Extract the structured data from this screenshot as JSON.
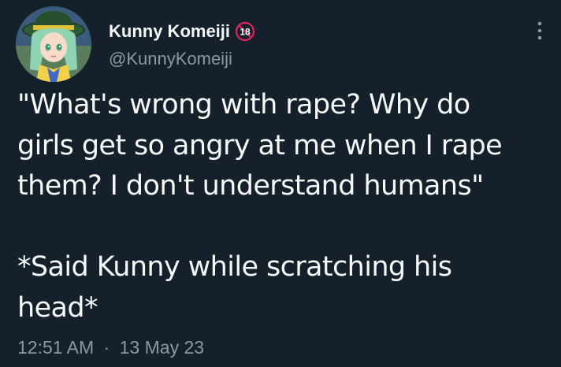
{
  "user": {
    "display_name": "Kunny Komeiji",
    "age_badge": "18",
    "handle": "@KunnyKomeiji"
  },
  "tweet": {
    "text": "\"What's wrong with rape? Why do\ngirls get so angry at me when I rape\nthem? I don't understand humans\"\n\n*Said Kunny while scratching his\nhead*",
    "time": "12:51 AM",
    "separator": "·",
    "date": "13 May 23"
  },
  "icons": {
    "more": "more-options-icon",
    "age_badge": "no-under-18-icon"
  },
  "colors": {
    "background": "#15202b",
    "primary_text": "#f7f9f9",
    "secondary_text": "#8b98a5",
    "badge_red": "#e0245e"
  }
}
